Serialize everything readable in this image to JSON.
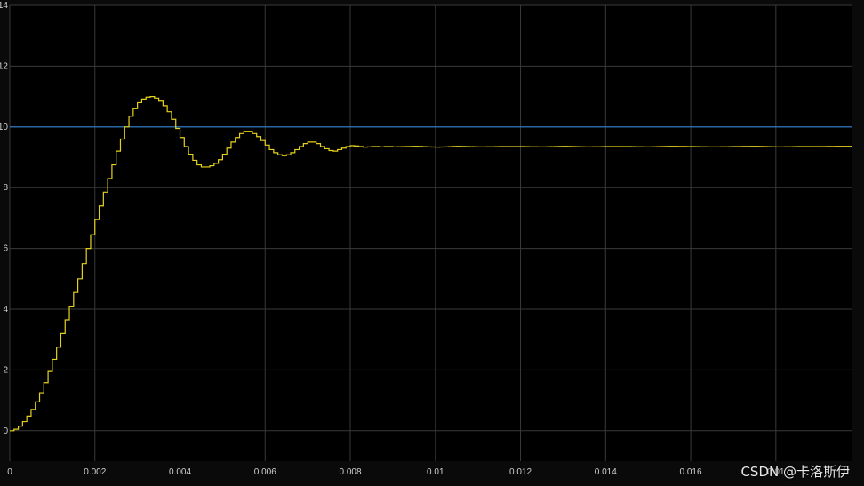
{
  "chart_data": {
    "type": "line",
    "xlim": [
      0,
      0.0198
    ],
    "ylim": [
      -1,
      14
    ],
    "x_ticks": [
      0,
      0.002,
      0.004,
      0.006,
      0.008,
      0.01,
      0.012,
      0.014,
      0.016,
      0.018
    ],
    "x_tick_labels": [
      "0",
      "0.002",
      "0.004",
      "0.006",
      "0.008",
      "0.01",
      "0.012",
      "0.014",
      "0.016",
      "0.01"
    ],
    "y_ticks": [
      0,
      2,
      4,
      6,
      8,
      10,
      12,
      14
    ],
    "y_tick_labels": [
      "0",
      "2",
      "4",
      "6",
      "8",
      "10",
      "12",
      "14"
    ],
    "grid": true,
    "background": "#000000",
    "series": [
      {
        "style": "stairs",
        "color": "#e6d21e",
        "sample_time": 0.0001,
        "x": [
          0,
          0.0001,
          0.0002,
          0.0003,
          0.0004,
          0.0005,
          0.0006,
          0.0007,
          0.0008,
          0.0009,
          0.001,
          0.0011,
          0.0012,
          0.0013,
          0.0014,
          0.0015,
          0.0016,
          0.0017,
          0.0018,
          0.0019,
          0.002,
          0.0021,
          0.0022,
          0.0023,
          0.0024,
          0.0025,
          0.0026,
          0.0027,
          0.0028,
          0.0029,
          0.003,
          0.0031,
          0.0032,
          0.0033,
          0.0034,
          0.0035,
          0.0036,
          0.0037,
          0.0038,
          0.0039,
          0.004,
          0.0041,
          0.0042,
          0.0043,
          0.0044,
          0.0045,
          0.0046,
          0.0047,
          0.0048,
          0.0049,
          0.005,
          0.0051,
          0.0052,
          0.0053,
          0.0054,
          0.0055,
          0.0056,
          0.0057,
          0.0058,
          0.0059,
          0.006,
          0.0061,
          0.0062,
          0.0063,
          0.0064,
          0.0065,
          0.0066,
          0.0067,
          0.0068,
          0.0069,
          0.007,
          0.0071,
          0.0072,
          0.0073,
          0.0074,
          0.0075,
          0.0076,
          0.0077,
          0.0078,
          0.0079,
          0.008,
          0.0081,
          0.0082,
          0.0083,
          0.0084,
          0.0085,
          0.0086,
          0.0087,
          0.0088,
          0.0089,
          0.009,
          0.0095,
          0.01,
          0.0105,
          0.011,
          0.0115,
          0.012,
          0.0125,
          0.013,
          0.0135,
          0.014,
          0.0145,
          0.015,
          0.0155,
          0.016,
          0.0165,
          0.017,
          0.0175,
          0.018,
          0.0185,
          0.019,
          0.0195
        ],
        "y": [
          0,
          0.05,
          0.15,
          0.3,
          0.48,
          0.7,
          0.95,
          1.25,
          1.58,
          1.95,
          2.35,
          2.75,
          3.2,
          3.65,
          4.1,
          4.55,
          5.0,
          5.5,
          6.0,
          6.45,
          6.95,
          7.4,
          7.85,
          8.3,
          8.75,
          9.2,
          9.6,
          10.0,
          10.35,
          10.6,
          10.8,
          10.92,
          10.98,
          11.0,
          10.95,
          10.85,
          10.7,
          10.5,
          10.25,
          9.95,
          9.65,
          9.35,
          9.1,
          8.9,
          8.75,
          8.68,
          8.68,
          8.72,
          8.8,
          8.92,
          9.1,
          9.3,
          9.5,
          9.65,
          9.78,
          9.84,
          9.84,
          9.78,
          9.68,
          9.55,
          9.4,
          9.25,
          9.15,
          9.08,
          9.05,
          9.08,
          9.15,
          9.25,
          9.35,
          9.45,
          9.5,
          9.5,
          9.45,
          9.35,
          9.28,
          9.22,
          9.2,
          9.25,
          9.3,
          9.35,
          9.38,
          9.37,
          9.35,
          9.33,
          9.34,
          9.35,
          9.35,
          9.34,
          9.35,
          9.35,
          9.34,
          9.36,
          9.33,
          9.36,
          9.34,
          9.35,
          9.35,
          9.34,
          9.36,
          9.34,
          9.35,
          9.35,
          9.34,
          9.36,
          9.35,
          9.34,
          9.35,
          9.36,
          9.34,
          9.35,
          9.35,
          9.36
        ]
      },
      {
        "style": "line",
        "color": "#2f7fd0",
        "x": [
          0,
          0.0198
        ],
        "y": [
          10,
          10
        ]
      }
    ]
  },
  "watermark": "CSDN @卡洛斯伊"
}
